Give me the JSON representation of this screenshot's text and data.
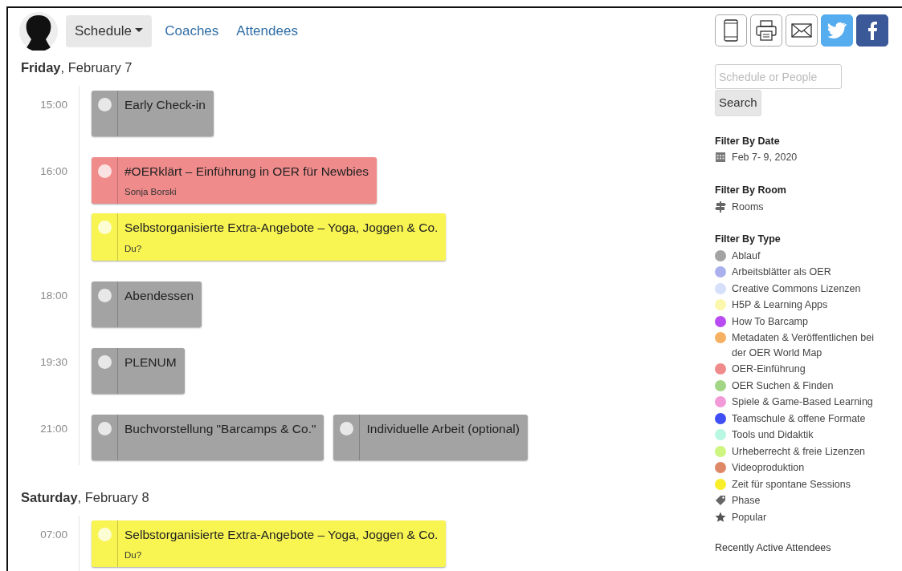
{
  "nav": {
    "items": [
      {
        "label": "Schedule",
        "kind": "dropdown",
        "selected": true
      },
      {
        "label": "Coaches",
        "kind": "link",
        "selected": false
      },
      {
        "label": "Attendees",
        "kind": "link",
        "selected": false
      }
    ]
  },
  "share_buttons": [
    {
      "kind": "phone"
    },
    {
      "kind": "print"
    },
    {
      "kind": "mail"
    },
    {
      "kind": "twitter"
    },
    {
      "kind": "facebook"
    }
  ],
  "days": [
    {
      "weekday": "Friday",
      "date": ", February 7",
      "slots": [
        {
          "time": "15:00",
          "sessions": [
            {
              "title": "Early Check-in",
              "color": "#a3a3a3"
            }
          ]
        },
        {
          "time": "16:00",
          "sessions": [
            {
              "title": "#OERklärt – Einführung in OER für Newbies",
              "speaker": "Sonja Borski",
              "color": "#f08b8b"
            }
          ]
        },
        {
          "sessions": [
            {
              "title": "Selbstorganisierte Extra-Angebote – Yoga, Joggen & Co.",
              "speaker": "Du?",
              "color": "#f8f552"
            }
          ]
        },
        {
          "time": "18:00",
          "sessions": [
            {
              "title": "Abendessen",
              "color": "#a3a3a3"
            }
          ]
        },
        {
          "time": "19:30",
          "sessions": [
            {
              "title": "PLENUM",
              "color": "#a3a3a3"
            }
          ]
        },
        {
          "time": "21:00",
          "sessions": [
            {
              "title": "Buchvorstellung \"Barcamps & Co.\"",
              "color": "#a3a3a3"
            },
            {
              "title": "Individuelle Arbeit (optional)",
              "color": "#a3a3a3"
            }
          ]
        }
      ]
    },
    {
      "weekday": "Saturday",
      "date": ", February 8",
      "slots": [
        {
          "time": "07:00",
          "sessions": [
            {
              "title": "Selbstorganisierte Extra-Angebote – Yoga, Joggen & Co.",
              "speaker": "Du?",
              "color": "#f8f552"
            }
          ]
        }
      ]
    }
  ],
  "search": {
    "placeholder": "Schedule or People",
    "button": "Search"
  },
  "filter_date": {
    "title": "Filter By Date",
    "value": "Feb 7- 9, 2020"
  },
  "filter_room": {
    "title": "Filter By Room",
    "value": "Rooms"
  },
  "filter_type": {
    "title": "Filter By Type",
    "items": [
      {
        "label": "Ablauf",
        "kind": "dot",
        "color": "#a3a3a3"
      },
      {
        "label": "Arbeitsblätter als OER",
        "kind": "dot",
        "color": "#aab0ee"
      },
      {
        "label": "Creative Commons Lizenzen",
        "kind": "dot",
        "color": "#d6e0fb"
      },
      {
        "label": "H5P & Learning Apps",
        "kind": "dot",
        "color": "#fbf7ad"
      },
      {
        "label": "How To Barcamp",
        "kind": "dot",
        "color": "#b84cf2"
      },
      {
        "label": "Metadaten & Veröffentlichen bei der OER World Map",
        "kind": "dot",
        "color": "#f6b062"
      },
      {
        "label": "OER-Einführung",
        "kind": "dot",
        "color": "#f08b8b"
      },
      {
        "label": "OER Suchen & Finden",
        "kind": "dot",
        "color": "#a2d586"
      },
      {
        "label": "Spiele & Game-Based Learning",
        "kind": "dot",
        "color": "#f29ad8"
      },
      {
        "label": "Teamschule & offene Formate",
        "kind": "dot",
        "color": "#3f4ef5"
      },
      {
        "label": "Tools und Didaktik",
        "kind": "dot",
        "color": "#b8f7e2"
      },
      {
        "label": "Urheberrecht & freie Lizenzen",
        "kind": "dot",
        "color": "#cdf57f"
      },
      {
        "label": "Videoproduktion",
        "kind": "dot",
        "color": "#df8867"
      },
      {
        "label": "Zeit für spontane Sessions",
        "kind": "dot",
        "color": "#f8ee2a"
      },
      {
        "label": "Phase",
        "kind": "tag"
      },
      {
        "label": "Popular",
        "kind": "star"
      }
    ]
  },
  "recent_title": "Recently Active Attendees"
}
